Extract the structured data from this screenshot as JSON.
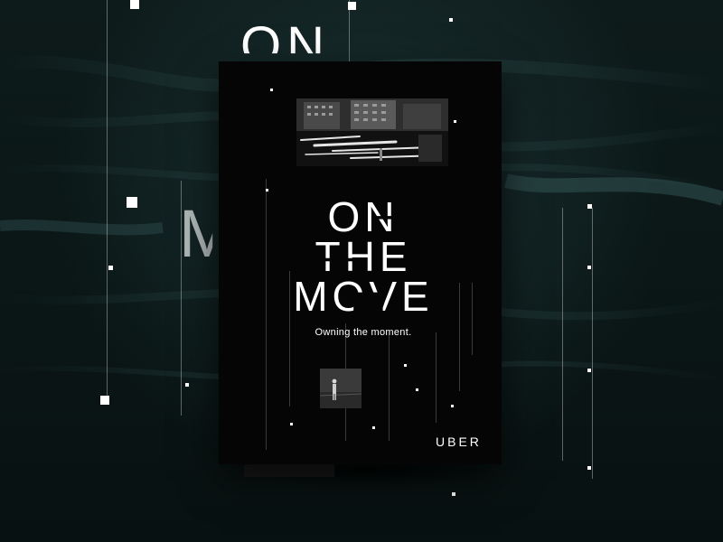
{
  "background_text": {
    "top_word": "ON",
    "side_letter": "M"
  },
  "poster": {
    "headline_lines": [
      "ON",
      "THE",
      "MOVE"
    ],
    "tagline": "Owning the moment.",
    "brand": "UBER"
  },
  "colors": {
    "background": "#0a1414",
    "poster": "#050505",
    "text": "#ffffff"
  }
}
